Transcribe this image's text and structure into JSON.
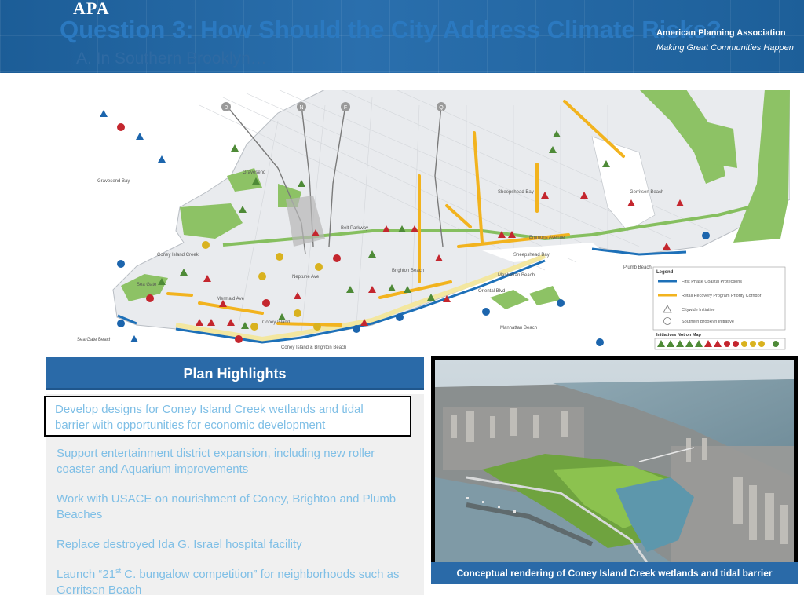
{
  "header": {
    "logo": "APA",
    "title": "Question 3: How Should the City Address Climate Risks?",
    "subtitle": "A. In Southern Brooklyn…",
    "organization": "American Planning Association",
    "tagline": "Making Great Communities Happen"
  },
  "map": {
    "labels": {
      "gravesend_bay": "Gravesend Bay",
      "gravesend": "Gravesend",
      "sheepshead_bay_nbhd": "Sheepshead Bay",
      "sheepshead_bay": "Sheepshead Bay",
      "coney_island_creek": "Coney Island Creek",
      "sea_gate": "Sea Gate",
      "sea_gate_beach": "Sea Gate Beach",
      "coney_island": "Coney Island",
      "coney_brighton_beach": "Coney Island & Brighton Beach",
      "brighton_beach": "Brighton Beach",
      "manhattan_beach_nbhd": "Manhattan Beach",
      "manhattan_beach": "Manhattan Beach",
      "plumb_beach": "Plumb Beach",
      "gerritsen_beach": "Gerritsen Beach",
      "belt_parkway": "Belt Parkway",
      "emmons_avenue": "Emmons Avenue",
      "neptune_ave": "Neptune Ave",
      "mermaid_ave": "Mermaid Ave",
      "ocean_pkwy": "Ocean Parkway",
      "coney_island_ave": "Coney Island Ave",
      "nostrand_ave": "Nostrand Ave",
      "ocean_ave": "Ocean Ave",
      "oriental_blvd": "Oriental Blvd",
      "cropsey_ave": "Cropsey Ave",
      "gerritsen_ave": "Gerritsen Ave"
    },
    "subway_lines": [
      "D",
      "N",
      "F",
      "Q"
    ],
    "legend": {
      "title": "Legend",
      "items": [
        "First Phase Coastal Protections",
        "Retail Recovery Program Priority Corridor",
        "Citywide Initiative",
        "Southern Brooklyn Initiative"
      ],
      "not_on_map_title": "Initiatives Not on Map"
    },
    "colors": {
      "park": "#8dc265",
      "water": "#ffffff",
      "land": "#e9ebee",
      "coast": "#1d70b8",
      "corridor": "#f2b31e",
      "initiative_red": "#c4262e",
      "initiative_green": "#4e8a37",
      "initiative_yellow": "#d9b21f",
      "initiative_blue": "#1c65ad"
    }
  },
  "highlights": {
    "heading": "Plan Highlights",
    "items": [
      {
        "text": "Develop designs for Coney Island Creek wetlands and tidal barrier with opportunities for economic development"
      },
      {
        "text": "Support entertainment district expansion, including new roller coaster and Aquarium improvements"
      },
      {
        "text": "Work with USACE on nourishment of Coney, Brighton and Plumb Beaches"
      },
      {
        "text": "Replace destroyed Ida G. Israel hospital facility"
      },
      {
        "text_before": "Launch “21",
        "sup": "st",
        "text_after": " C. bungalow competition” for neighborhoods such as Gerritsen Beach"
      }
    ]
  },
  "photo": {
    "caption": "Conceptual rendering of Coney Island Creek wetlands and tidal barrier"
  }
}
